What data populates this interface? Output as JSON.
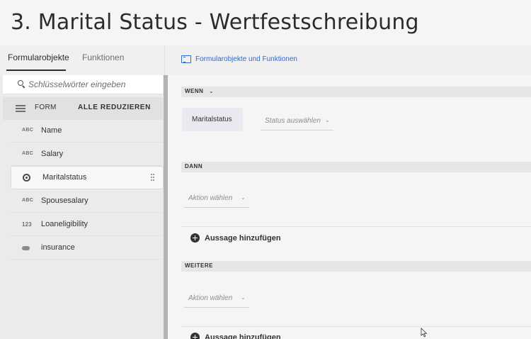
{
  "title": "3. Marital Status - Wertfestschreibung",
  "tabs": {
    "objects": "Formularobjekte",
    "functions": "Funktionen"
  },
  "breadcrumb": {
    "label": "Formularobjekte und Funktionen",
    "icon": "panel-icon",
    "color": "#2d6ad4"
  },
  "sidebar": {
    "search_placeholder": "Schlüsselwörter eingeben",
    "form_label": "FORM",
    "collapse_all": "ALLE REDUZIEREN",
    "items": [
      {
        "type": "ABC",
        "label": "Name",
        "icon": "text-field-icon"
      },
      {
        "type": "ABC",
        "label": "Salary",
        "icon": "text-field-icon"
      },
      {
        "type": "",
        "label": "Maritalstatus",
        "icon": "radio-button-icon",
        "selected": true
      },
      {
        "type": "ABC",
        "label": "Spousesalary",
        "icon": "text-field-icon"
      },
      {
        "type": "123",
        "label": "Loaneligibility",
        "icon": "numeric-field-icon"
      },
      {
        "type": "",
        "label": "insurance",
        "icon": "toggle-icon"
      }
    ]
  },
  "rule": {
    "when": {
      "header": "WENN",
      "object": "Maritalstatus",
      "status_placeholder": "Status auswählen"
    },
    "then": {
      "header": "DANN",
      "action_placeholder": "Aktion wählen",
      "add_statement": "Aussage hinzufügen"
    },
    "else": {
      "header": "WEITERE",
      "action_placeholder": "Aktion wählen",
      "add_statement": "Aussage hinzufügen"
    }
  }
}
